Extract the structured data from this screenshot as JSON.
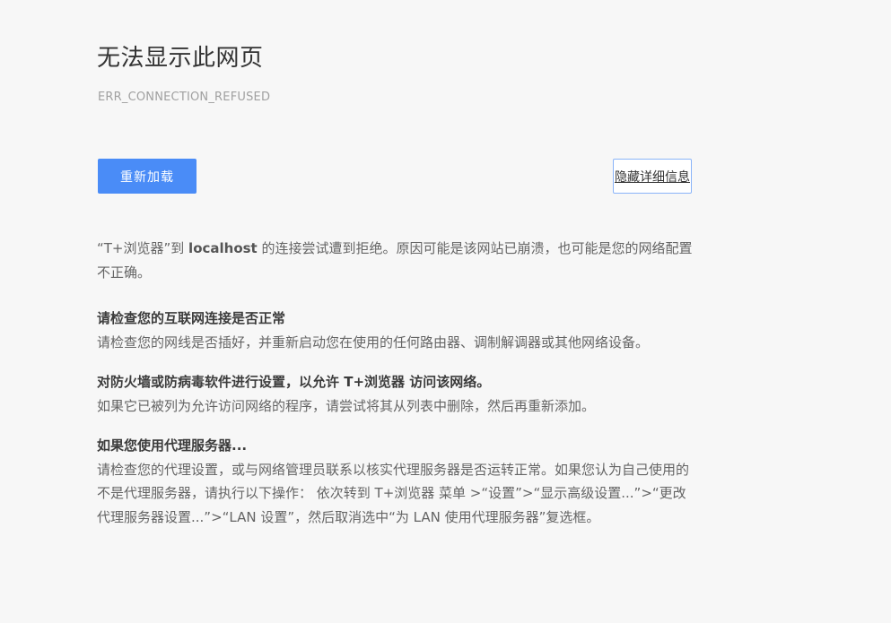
{
  "title": "无法显示此网页",
  "error_code": "ERR_CONNECTION_REFUSED",
  "buttons": {
    "reload": "重新加载",
    "hide_details": "隐藏详细信息"
  },
  "summary": {
    "prefix": "“T+浏览器”到 ",
    "host": "localhost",
    "suffix": " 的连接尝试遭到拒绝。原因可能是该网站已崩溃，也可能是您的网络配置不正确。"
  },
  "sections": [
    {
      "heading": "请检查您的互联网连接是否正常",
      "body": "请检查您的网线是否插好，并重新启动您在使用的任何路由器、调制解调器或其他网络设备。"
    },
    {
      "heading": "对防火墙或防病毒软件进行设置，以允许 T+浏览器 访问该网络。",
      "body": "如果它已被列为允许访问网络的程序，请尝试将其从列表中删除，然后再重新添加。"
    },
    {
      "heading": "如果您使用代理服务器...",
      "body": "请检查您的代理设置，或与网络管理员联系以核实代理服务器是否运转正常。如果您认为自己使用的不是代理服务器，请执行以下操作： 依次转到 T+浏览器 菜单 >“设置”>“显示高级设置...”>“更改代理服务器设置...”>“LAN 设置”，然后取消选中“为 LAN 使用代理服务器”复选框。"
    }
  ]
}
